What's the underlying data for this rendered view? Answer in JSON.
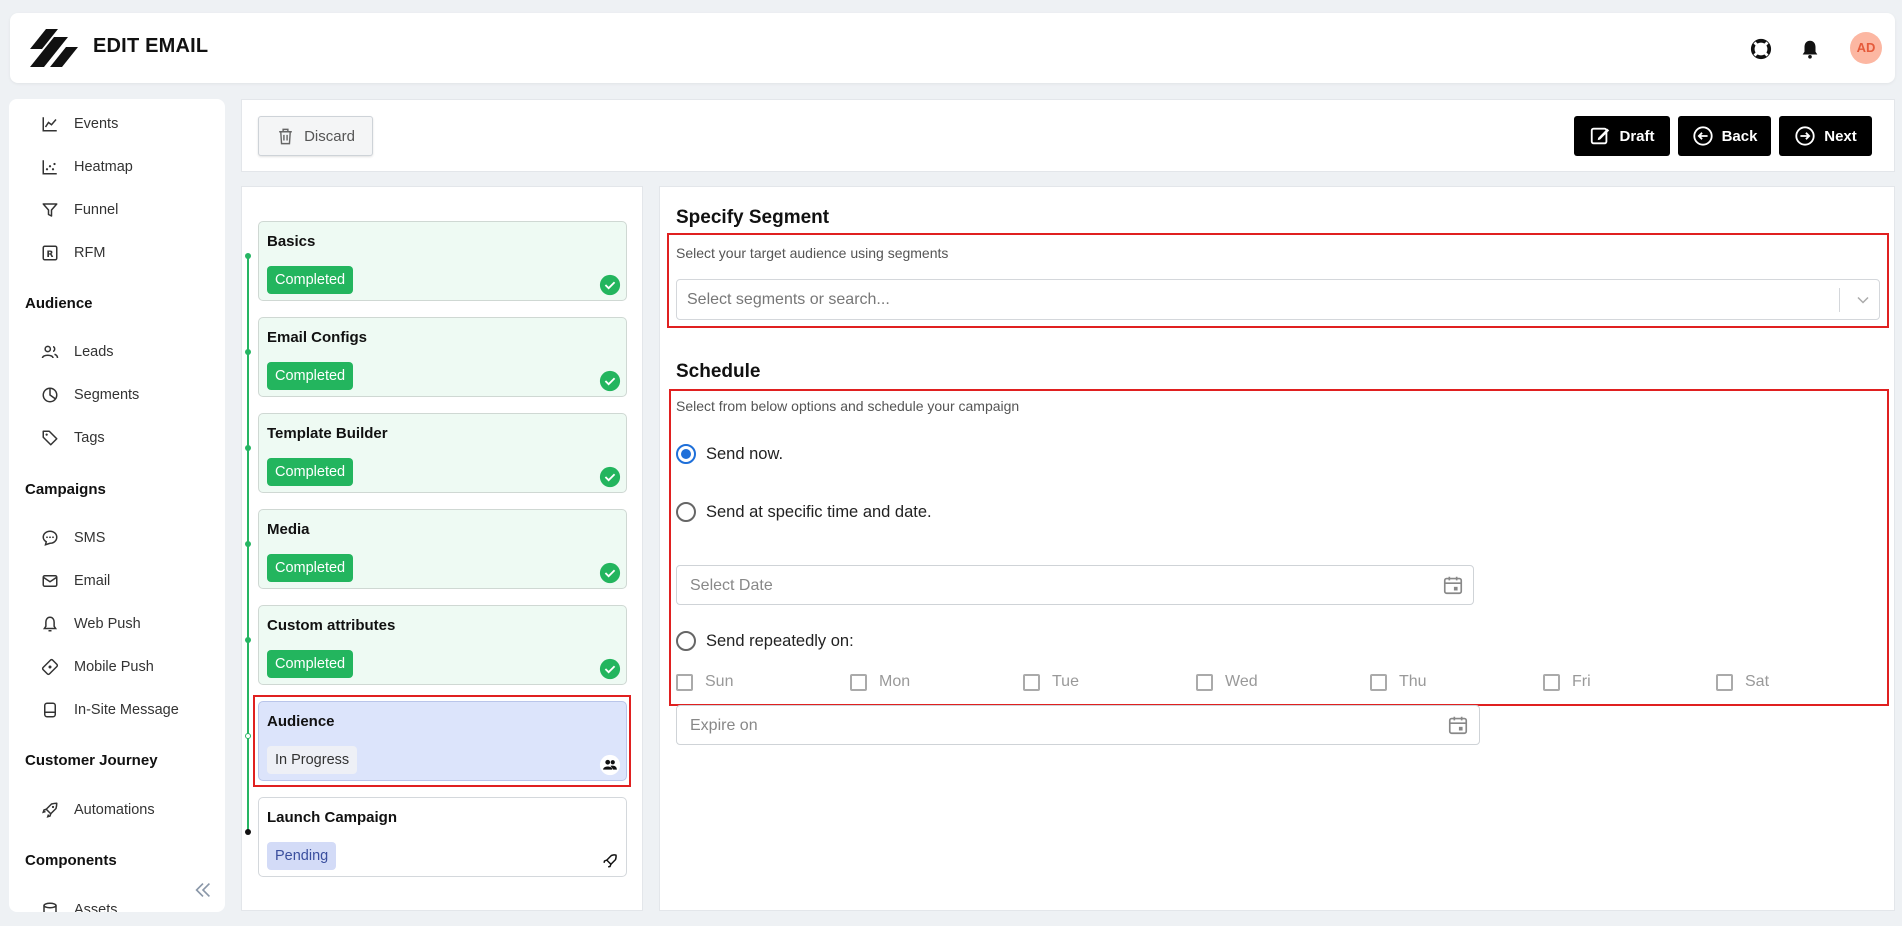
{
  "header": {
    "title": "EDIT EMAIL",
    "avatar_initials": "AD",
    "icons": [
      "help-lifebuoy-icon",
      "bell-icon"
    ]
  },
  "sidebar": {
    "items": [
      {
        "label": "Events",
        "icon": "line-chart-icon"
      },
      {
        "label": "Heatmap",
        "icon": "heatmap-icon"
      },
      {
        "label": "Funnel",
        "icon": "funnel-icon"
      },
      {
        "label": "RFM",
        "icon": "rfm-icon"
      }
    ],
    "groups": [
      {
        "title": "Audience",
        "items": [
          {
            "label": "Leads",
            "icon": "users-icon"
          },
          {
            "label": "Segments",
            "icon": "pie-chart-icon"
          },
          {
            "label": "Tags",
            "icon": "tag-icon"
          }
        ]
      },
      {
        "title": "Campaigns",
        "items": [
          {
            "label": "SMS",
            "icon": "chat-bubble-icon"
          },
          {
            "label": "Email",
            "icon": "mail-icon"
          },
          {
            "label": "Web Push",
            "icon": "bell-outline-icon"
          },
          {
            "label": "Mobile Push",
            "icon": "mobile-push-icon"
          },
          {
            "label": "In-Site Message",
            "icon": "monitor-icon"
          }
        ]
      },
      {
        "title": "Customer Journey",
        "items": [
          {
            "label": "Automations",
            "icon": "rocket-icon"
          }
        ]
      },
      {
        "title": "Components",
        "items": [
          {
            "label": "Assets",
            "icon": "database-icon"
          }
        ]
      }
    ]
  },
  "toolbar": {
    "discard_label": "Discard",
    "draft_label": "Draft",
    "back_label": "Back",
    "next_label": "Next"
  },
  "steps": [
    {
      "title": "Basics",
      "status": "Completed",
      "state": "done"
    },
    {
      "title": "Email Configs",
      "status": "Completed",
      "state": "done"
    },
    {
      "title": "Template Builder",
      "status": "Completed",
      "state": "done"
    },
    {
      "title": "Media",
      "status": "Completed",
      "state": "done"
    },
    {
      "title": "Custom attributes",
      "status": "Completed",
      "state": "done"
    },
    {
      "title": "Audience",
      "status": "In Progress",
      "state": "active"
    },
    {
      "title": "Launch Campaign",
      "status": "Pending",
      "state": "pending"
    }
  ],
  "segment": {
    "title": "Specify Segment",
    "description": "Select your target audience using segments",
    "placeholder": "Select segments or search..."
  },
  "schedule": {
    "title": "Schedule",
    "description": "Select from below options and schedule your campaign",
    "options": [
      {
        "label": "Send now.",
        "selected": true
      },
      {
        "label": "Send at specific time and date.",
        "selected": false
      },
      {
        "label": "Send repeatedly on:",
        "selected": false
      }
    ],
    "date_placeholder": "Select Date",
    "days": [
      "Sun",
      "Mon",
      "Tue",
      "Wed",
      "Thu",
      "Fri",
      "Sat"
    ],
    "expire_placeholder": "Expire on"
  },
  "colors": {
    "accent_green": "#23b55e",
    "active_step": "#dce4fb",
    "highlight_red": "#e02020",
    "radio_blue": "#1e6fd9"
  }
}
